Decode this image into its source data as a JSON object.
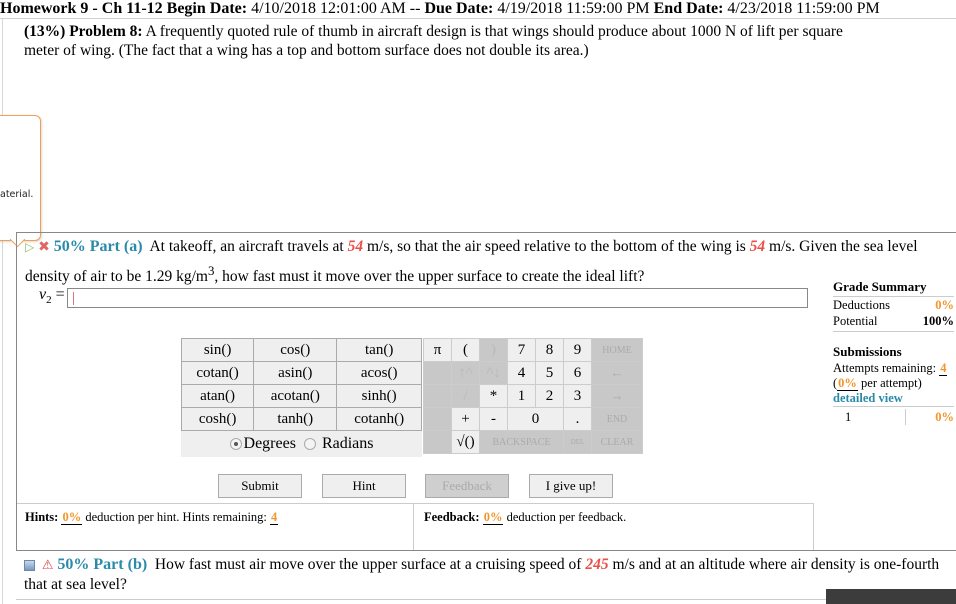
{
  "header": {
    "assignment": "Homework 9 - Ch 11-12",
    "begin_label": "Begin Date:",
    "begin_value": "4/10/2018 12:01:00 AM",
    "sep": "--",
    "due_label": "Due Date:",
    "due_value": "4/19/2018 11:59:00 PM",
    "end_label": "End Date:",
    "end_value": "4/23/2018 11:59:00 PM"
  },
  "problem": {
    "label": "(13%) Problem 8:",
    "text": "A frequently quoted rule of thumb in aircraft design is that wings should produce about 1000 N of lift per square meter of wing. (The fact that a wing has a top and bottom surface does not double its area.)"
  },
  "tooltip": {
    "text": "aterial."
  },
  "part_a": {
    "label": "50% Part (a)",
    "text1": "At takeoff, an aircraft travels at",
    "speed1": "54",
    "text2": "m/s, so that the air speed relative to the bottom of the wing is",
    "speed2": "54",
    "text3": "m/s. Given the sea level density of air to be 1.29 kg/m",
    "sup": "3",
    "text4": ", how fast must it move over the upper surface to create the ideal lift?",
    "answer_var": "v",
    "answer_sub": "2",
    "answer_eq": "=",
    "answer_value": ""
  },
  "grade_summary": {
    "title": "Grade Summary",
    "deductions_label": "Deductions",
    "deductions_value": "0%",
    "potential_label": "Potential",
    "potential_value": "100%"
  },
  "submissions": {
    "title": "Submissions",
    "attempts_label": "Attempts remaining:",
    "attempts_value": "4",
    "per_attempt_open": "(",
    "per_attempt_value": "0%",
    "per_attempt_text": "per attempt)",
    "detailed_view": "detailed view",
    "rows": [
      {
        "n": "1",
        "value": "0%"
      }
    ]
  },
  "keypad": {
    "functions": [
      [
        "sin()",
        "cos()",
        "tan()"
      ],
      [
        "cotan()",
        "asin()",
        "acos()"
      ],
      [
        "atan()",
        "acotan()",
        "sinh()"
      ],
      [
        "cosh()",
        "tanh()",
        "cotanh()"
      ]
    ],
    "degrees": "Degrees",
    "radians": "Radians",
    "angle_mode": "Degrees",
    "pi": "π",
    "lparen": "(",
    "rparen": ")",
    "up": "↑^",
    "down": "^↓",
    "div": "/",
    "mul": "*",
    "plus": "+",
    "minus": "-",
    "sqrt": "√()",
    "digits": [
      "7",
      "8",
      "9",
      "4",
      "5",
      "6",
      "1",
      "2",
      "3",
      "0",
      "."
    ],
    "home": "HOME",
    "left": "←",
    "right": "→",
    "end": "END",
    "backspace": "BACKSPACE",
    "del": "DEL",
    "clear": "CLEAR"
  },
  "buttons": {
    "submit": "Submit",
    "hint": "Hint",
    "feedback": "Feedback",
    "give_up": "I give up!"
  },
  "hints": {
    "label": "Hints:",
    "deduction": "0%",
    "text": "deduction per hint. Hints remaining:",
    "remaining": "4"
  },
  "feedback": {
    "label": "Feedback:",
    "deduction": "0%",
    "text": "deduction per feedback."
  },
  "part_b": {
    "label": "50% Part (b)",
    "text1": "How fast must air move over the upper surface at a cruising speed of",
    "speed": "245",
    "text2": "m/s and at an altitude where air density is one-fourth that at sea level?"
  }
}
